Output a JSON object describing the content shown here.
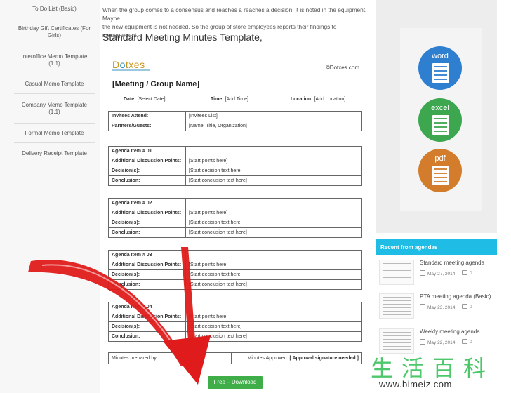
{
  "sidebar": {
    "items": [
      {
        "label": "To Do List (Basic)"
      },
      {
        "label": "Birthday Gift Certificates (For Girls)"
      },
      {
        "label": "Interoffice Memo Template (1.1)"
      },
      {
        "label": "Casual Memo Template"
      },
      {
        "label": "Company Memo Template (1.1)"
      },
      {
        "label": "Formal Memo Template"
      },
      {
        "label": "Delivery Receipt Template"
      }
    ]
  },
  "main": {
    "intro": "When the group comes to a consensus and reaches a reaches a decision, it is noted in the equipment. Maybe\nthe new equipment is not needed. So the group of store employees reports their findings to management.",
    "heading": "Standard Meeting Minutes Template,"
  },
  "document": {
    "logo_pre": "D",
    "logo_o": "o",
    "logo_post": "txes",
    "copyright": "©Dotxes.com",
    "title": "[Meeting / Group Name]",
    "date_label": "Date:",
    "date_value": "[Select Date]",
    "time_label": "Time:",
    "time_value": "[Add Time]",
    "location_label": "Location:",
    "location_value": "[Add Location]",
    "invitees_label": "Invitees Attend:",
    "invitees_value": "[Invitees List]",
    "partners_label": "Partners/Guests:",
    "partners_value": "[Name, Title, Organization]",
    "agenda_items": [
      {
        "label": "Agenda Item # 01"
      },
      {
        "label": "Agenda Item # 02"
      },
      {
        "label": "Agenda Item # 03"
      },
      {
        "label": "Agenda Item # 04"
      }
    ],
    "row_labels": {
      "points": "Additional Discussion Points:",
      "decision": "Decision(s):",
      "conclusion": "Conclusion:"
    },
    "row_values": {
      "points": "[Start points here]",
      "decision": "[Start decision text here]",
      "conclusion": "[Start conclusion text here]"
    },
    "prepared_by": "Minutes prepared by:",
    "approved_label": "Minutes Approved:",
    "approved_value": "[ Approval signature needed ]"
  },
  "download": {
    "label": "Free – Download"
  },
  "right": {
    "icons": {
      "word": "word",
      "excel": "excel",
      "pdf": "pdf"
    },
    "recent_header": "Recent from agendas",
    "recent": [
      {
        "title": "Standard meeting agenda",
        "date": "May 27, 2014",
        "comments": "0"
      },
      {
        "title": "PTA meeting agenda (Basic)",
        "date": "May 23, 2014",
        "comments": "0"
      },
      {
        "title": "Weekly meeting agenda",
        "date": "May 22, 2014",
        "comments": "0"
      }
    ]
  },
  "watermark": {
    "chars": "生活百科",
    "url": "www.bimeiz.com"
  },
  "colors": {
    "accent": "#1fbde6",
    "download": "#3fae49",
    "word": "#2f7fd0",
    "excel": "#3da74f",
    "pdf": "#d27c2c",
    "arrow": "#e01b1b"
  }
}
